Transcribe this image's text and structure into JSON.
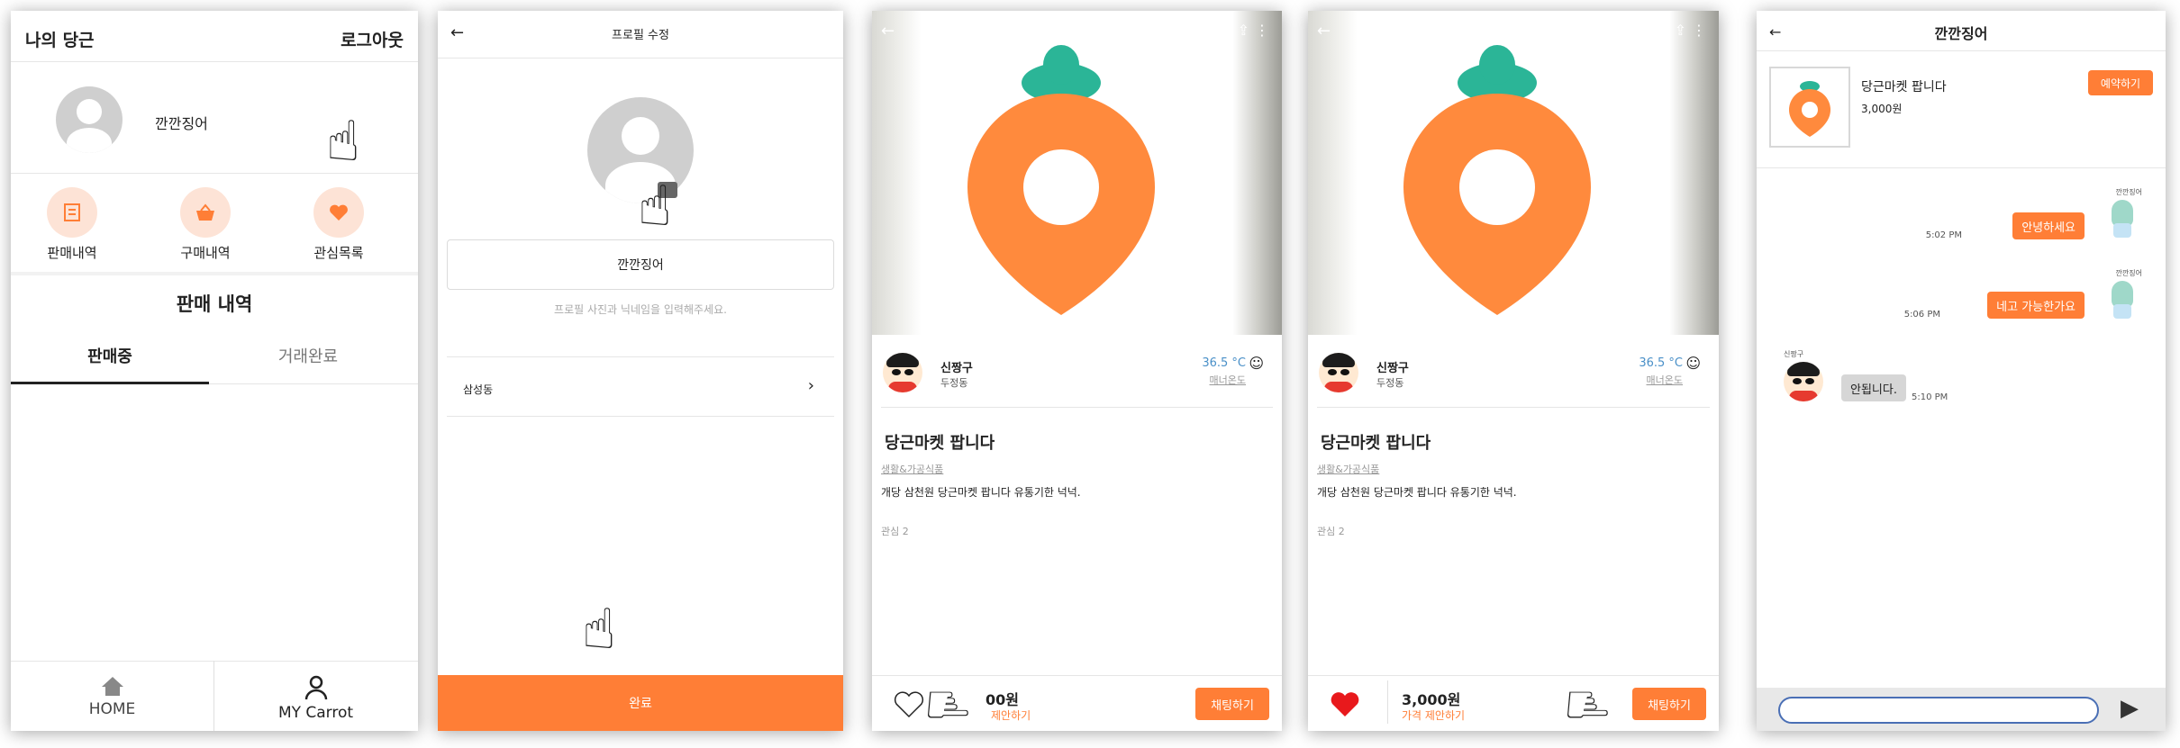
{
  "s1": {
    "title": "나의 당근",
    "logout": "로그아웃",
    "username": "깐깐징어",
    "menu": [
      {
        "label": "판매내역",
        "icon": "receipt-icon"
      },
      {
        "label": "구매내역",
        "icon": "basket-icon"
      },
      {
        "label": "관심목록",
        "icon": "heart-icon"
      }
    ],
    "section_title": "판매 내역",
    "tabs": [
      "판매중",
      "거래완료"
    ],
    "nav": [
      {
        "label": "HOME",
        "icon": "home-icon"
      },
      {
        "label": "MY Carrot",
        "icon": "person-icon"
      }
    ]
  },
  "s2": {
    "back": "←",
    "title": "프로필 수정",
    "nickname": "깐깐징어",
    "hint": "프로필 사진과 닉네임을 입력해주세요.",
    "location": "삼성동",
    "chevron": "›",
    "done": "완료"
  },
  "product": {
    "seller": "신짱구",
    "area": "두정동",
    "temp": "36.5 °C",
    "temp_label": "매너온도",
    "title": "당근마켓 팝니다",
    "category": "생활&가공식품",
    "desc": "개당 삼천원 당근마켓 팝니다 유통기한 넉넉.",
    "likes": "관심 2",
    "price": "3,000원",
    "offer": "가격 제안하기",
    "chat": "채팅하기",
    "s3_price_partial": "00원",
    "s3_offer_partial": "제안하기"
  },
  "s5": {
    "back": "←",
    "title": "깐깐징어",
    "product_title": "당근마켓 팝니다",
    "product_price": "3,000원",
    "reserve": "예약하기",
    "messages": [
      {
        "name": "깐깐징어",
        "text": "안녕하세요",
        "time": "5:02 PM"
      },
      {
        "name": "깐깐징어",
        "text": "네고 가능한가요",
        "time": "5:06 PM"
      },
      {
        "name": "신짱구",
        "text": "안됩니다.",
        "time": "5:10 PM"
      }
    ],
    "send": "▶"
  },
  "colors": {
    "accent": "#ff7e36",
    "temp": "#4a90c8",
    "carrot_leaf": "#2bb597"
  }
}
